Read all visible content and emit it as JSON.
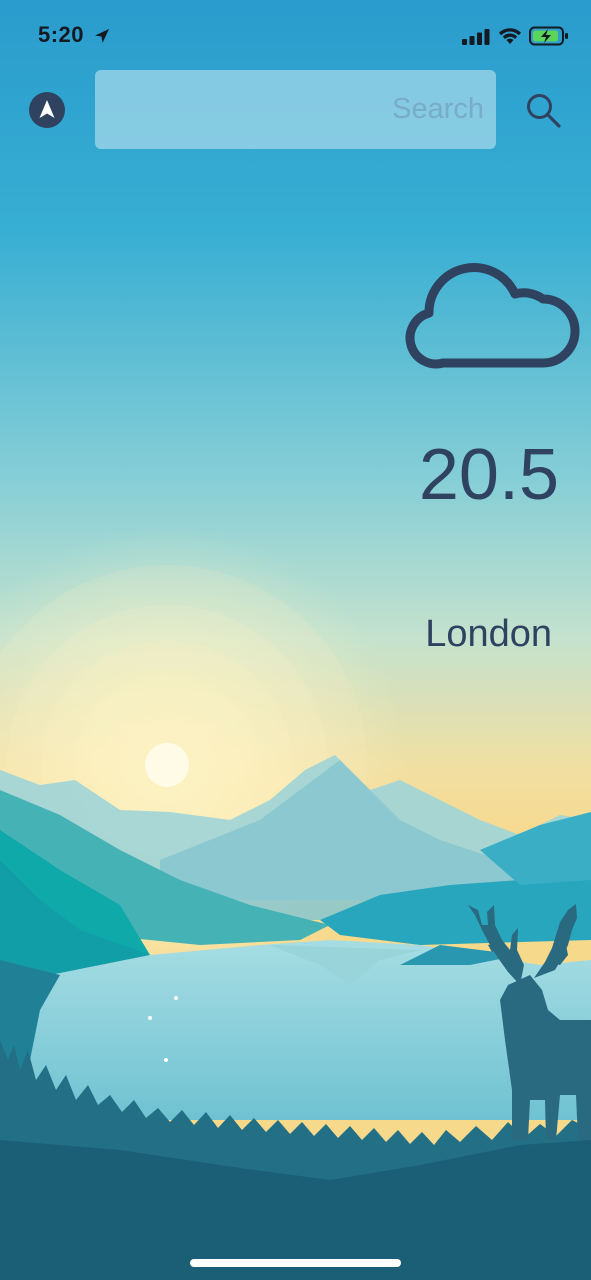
{
  "status_bar": {
    "time": "5:20",
    "location_icon": "location-arrow-icon",
    "signal_icon": "cellular-signal-icon",
    "wifi_icon": "wifi-icon",
    "battery_icon": "battery-charging-icon"
  },
  "header": {
    "nav_icon": "navigation-arrow-icon",
    "search": {
      "placeholder": "Search",
      "value": ""
    },
    "search_icon": "search-icon"
  },
  "weather": {
    "icon": "cloud-icon",
    "temperature": "20.5",
    "city": "London"
  },
  "colors": {
    "text": "#2f4260",
    "sky_top": "#2ea0d0",
    "sky_horizon": "#f6d98e",
    "sun": "#fffbe6",
    "lake": "#8fd3df",
    "forest": "#1d5d72",
    "deer": "#2a6a80",
    "battery_fill": "#5ad45a"
  },
  "background": {
    "scene": "sunrise lake landscape with mountains, forest and deer silhouette"
  }
}
